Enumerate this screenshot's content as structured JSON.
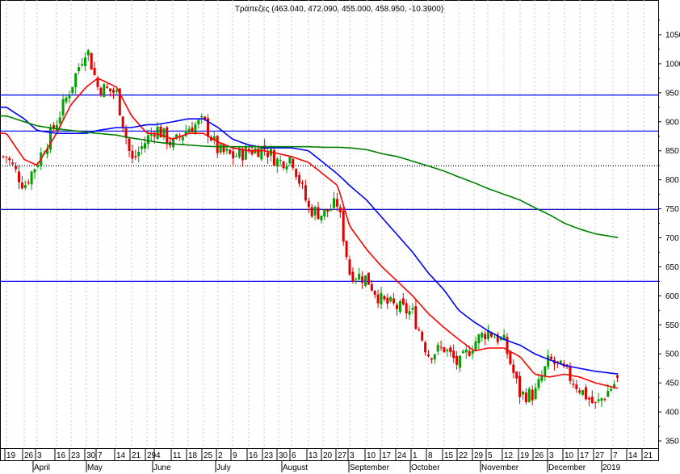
{
  "chart_data": {
    "type": "candlestick",
    "title": "Τράπεζες (463.040, 472.090, 455.000, 458.950, -10.3900)",
    "ylim": [
      340,
      1090
    ],
    "y_ticks": [
      350,
      400,
      450,
      500,
      550,
      600,
      650,
      700,
      750,
      800,
      850,
      900,
      950,
      1000,
      1050
    ],
    "week_labels": [
      "19",
      "26",
      "3",
      "16",
      "23",
      "30",
      "7",
      "14",
      "21",
      "29",
      "4",
      "11",
      "18",
      "25",
      "2",
      "9",
      "16",
      "23",
      "30",
      "6",
      "13",
      "20",
      "27",
      "3",
      "10",
      "17",
      "24",
      "1",
      "8",
      "15",
      "22",
      "29",
      "5",
      "12",
      "19",
      "26",
      "3",
      "10",
      "17",
      "27",
      "7",
      "14",
      "21"
    ],
    "month_labels": [
      "April",
      "May",
      "June",
      "July",
      "August",
      "September",
      "October",
      "November",
      "December",
      "2019"
    ],
    "weekly_close_approx": [
      840,
      790,
      830,
      900,
      960,
      1030,
      960,
      950,
      830,
      870,
      890,
      860,
      890,
      900,
      850,
      840,
      850,
      855,
      830,
      840,
      750,
      740,
      760,
      640,
      630,
      590,
      580,
      570,
      500,
      510,
      480,
      520,
      540,
      520,
      430,
      430,
      490,
      470,
      440,
      410,
      459
    ],
    "last_bar": {
      "open": 463.04,
      "high": 472.09,
      "low": 455.0,
      "close": 458.95,
      "change": -10.39
    },
    "moving_averages": [
      {
        "name": "short",
        "color": "#ff0000",
        "values": [
          880,
          835,
          825,
          880,
          930,
          960,
          975,
          960,
          910,
          880,
          880,
          870,
          880,
          880,
          865,
          855,
          850,
          850,
          845,
          840,
          830,
          810,
          790,
          720,
          680,
          650,
          625,
          600,
          570,
          545,
          525,
          505,
          510,
          510,
          495,
          465,
          460,
          465,
          460,
          450,
          440
        ]
      },
      {
        "name": "medium",
        "color": "#0000ff",
        "values": [
          925,
          905,
          885,
          880,
          880,
          880,
          885,
          890,
          890,
          895,
          895,
          900,
          905,
          905,
          890,
          870,
          860,
          855,
          855,
          855,
          850,
          830,
          810,
          790,
          765,
          735,
          705,
          675,
          640,
          610,
          575,
          555,
          540,
          525,
          515,
          500,
          490,
          480,
          475,
          470,
          465
        ]
      },
      {
        "name": "long",
        "color": "#008000",
        "values": [
          910,
          900,
          893,
          888,
          885,
          882,
          880,
          877,
          872,
          868,
          865,
          862,
          860,
          858,
          857,
          857,
          857,
          857,
          857,
          857,
          857,
          856,
          856,
          855,
          852,
          845,
          840,
          832,
          824,
          815,
          805,
          795,
          785,
          775,
          765,
          752,
          740,
          725,
          715,
          707,
          700
        ]
      }
    ],
    "horizontal_lines": [
      {
        "value": 946,
        "color": "#0000ff",
        "style": "solid"
      },
      {
        "value": 884,
        "color": "#0000ff",
        "style": "solid"
      },
      {
        "value": 824,
        "color": "#000000",
        "style": "dotted"
      },
      {
        "value": 749,
        "color": "#0000ff",
        "style": "solid"
      },
      {
        "value": 625,
        "color": "#0000ff",
        "style": "solid"
      }
    ],
    "colors": {
      "up": "#00a000",
      "down": "#e00000"
    }
  }
}
